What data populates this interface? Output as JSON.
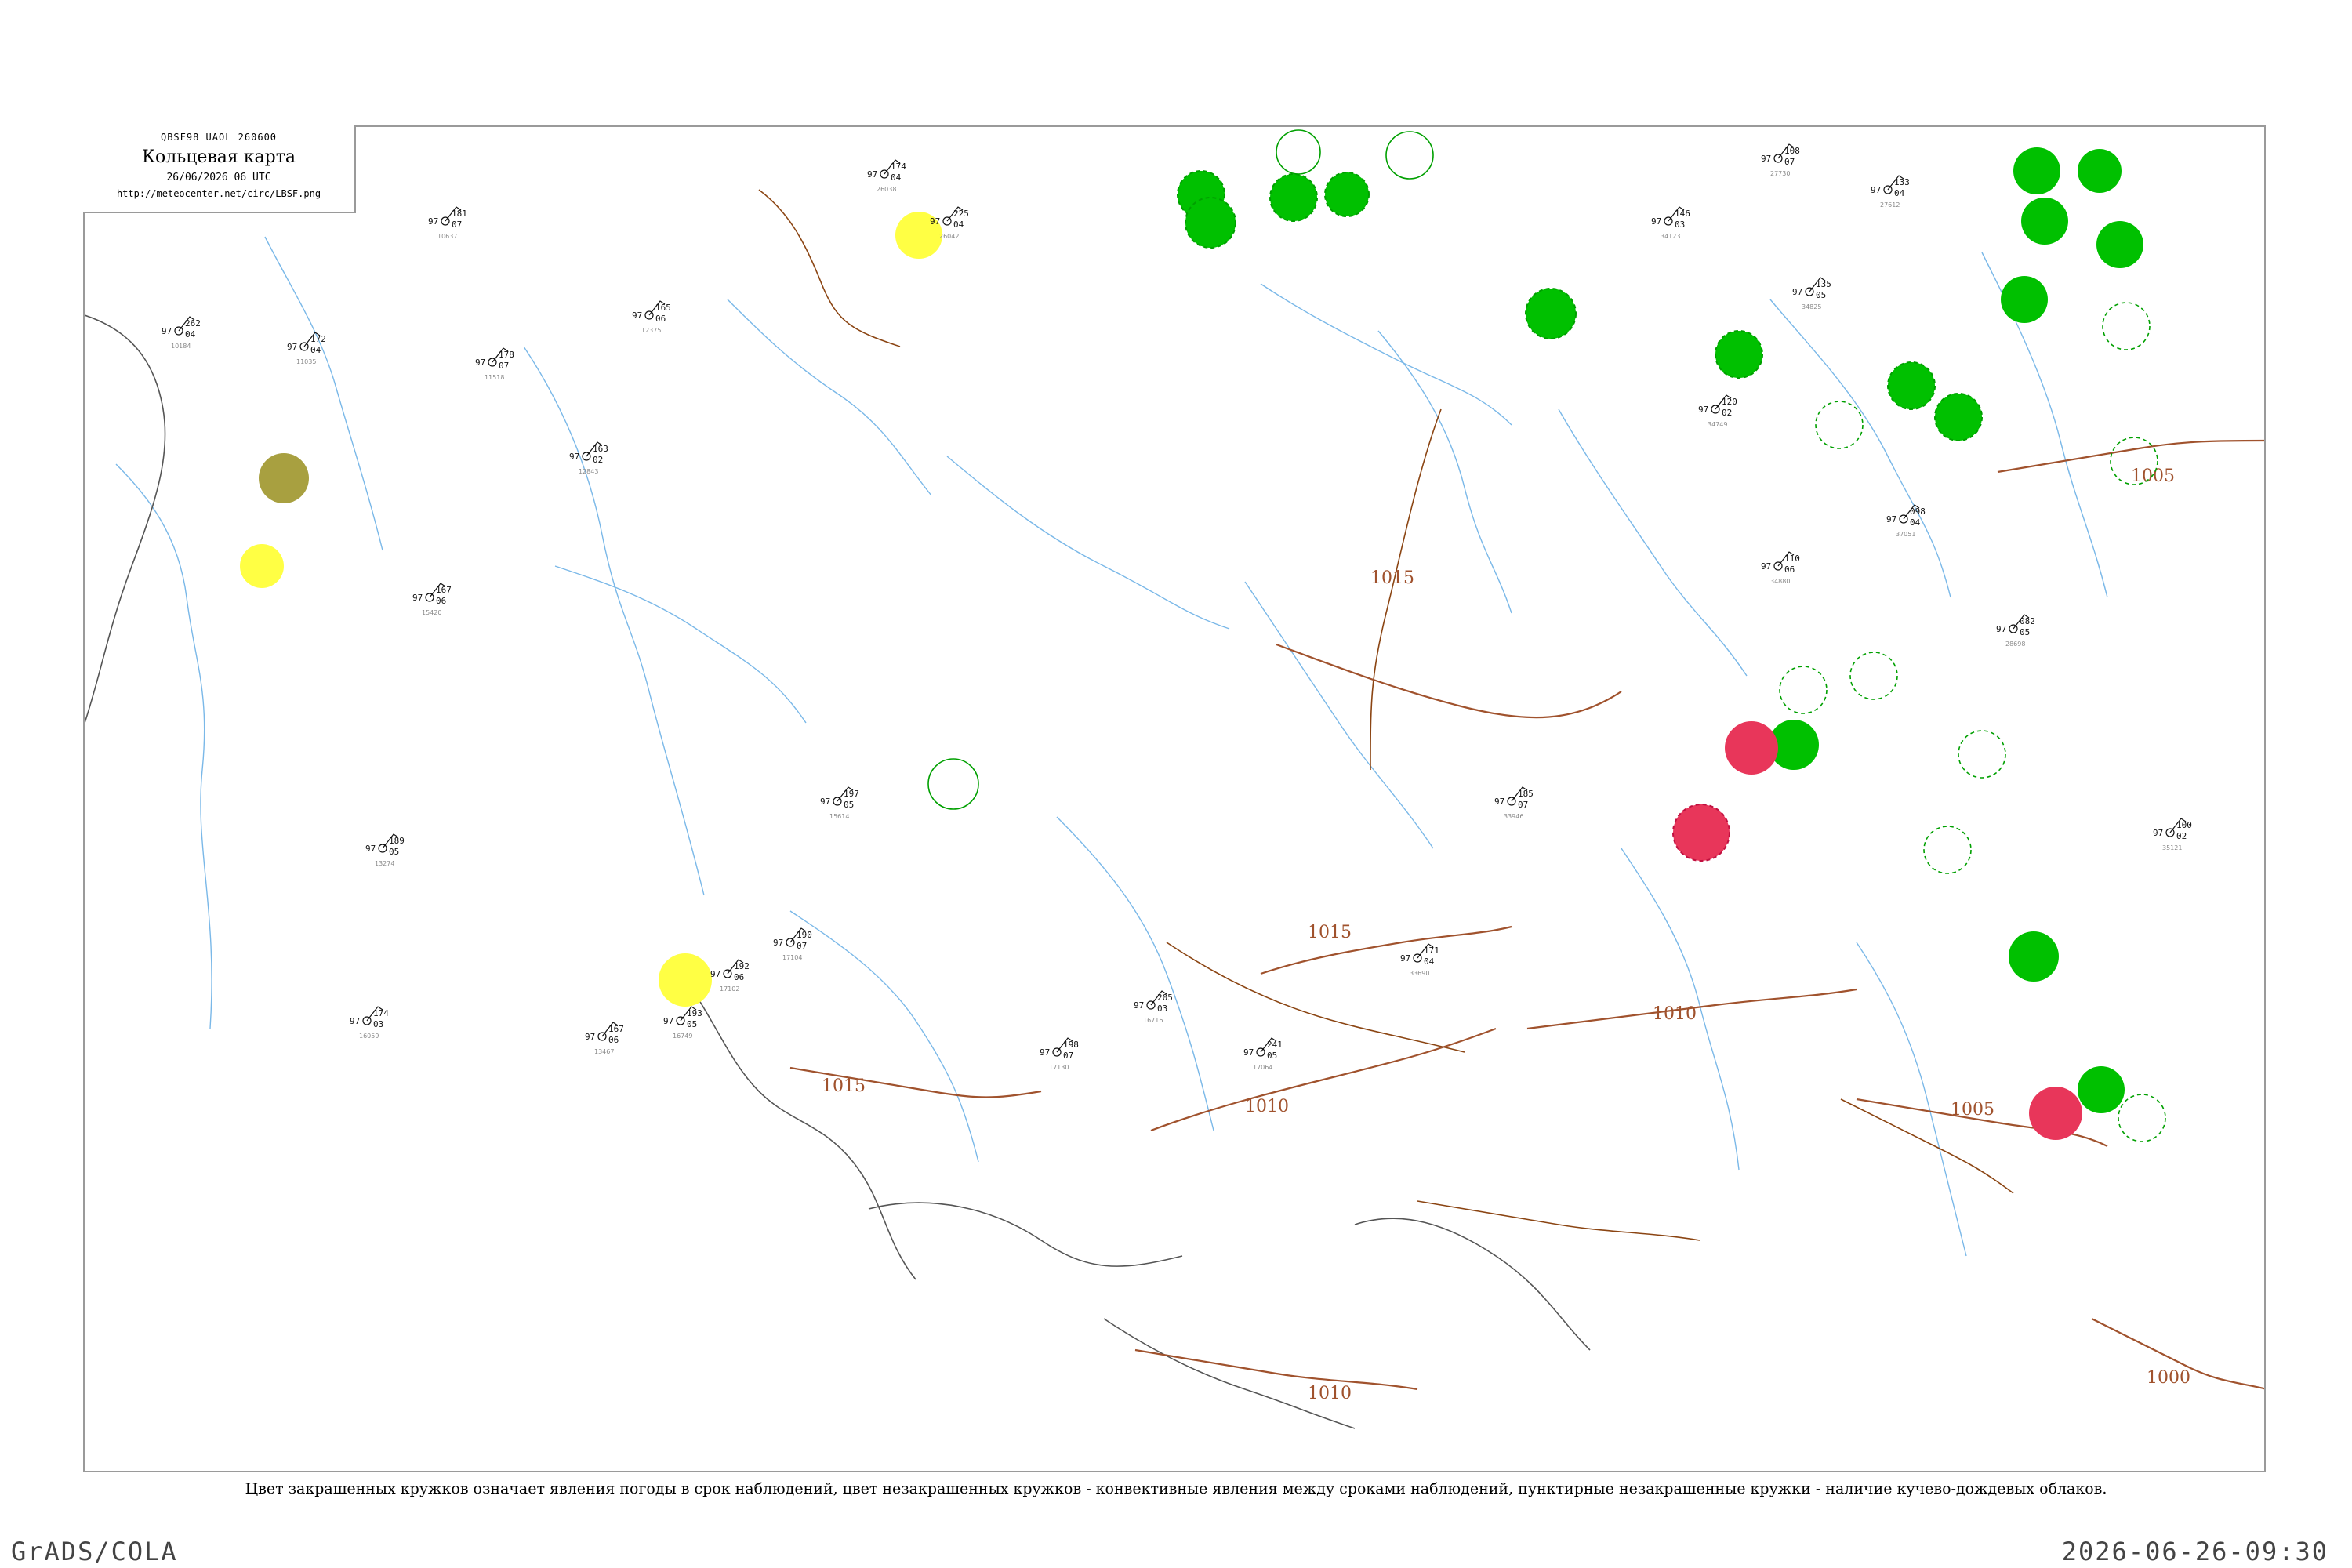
{
  "header": {
    "code_line": "QBSF98  UAOL  260600",
    "title": "Кольцевая карта",
    "date": "26/06/2026 06 UTC",
    "url": "http://meteocenter.net/circ/LBSF.png"
  },
  "caption": "Цвет закрашенных кружков означает явления погоды в срок наблюдений, цвет незакрашенных кружков - конвективные явления между сроками наблюдений, пунктирные незакрашенные кружки - наличие кучево-дождевых облаков.",
  "footer": {
    "left": "GrADS/COLA",
    "right": "2026-06-26-09:30"
  },
  "isobars": [
    {
      "label": "1015"
    },
    {
      "label": "1015"
    },
    {
      "label": "1015"
    },
    {
      "label": "1010"
    },
    {
      "label": "1010"
    },
    {
      "label": "1010"
    },
    {
      "label": "1005"
    },
    {
      "label": "1005"
    },
    {
      "label": "1000"
    }
  ],
  "colors": {
    "rain": "#00c000",
    "thunder": "#e8365a",
    "fog": "#ffff44",
    "haze": "#a8a040",
    "isobar": "#a0522d",
    "river": "#7ab8e8",
    "border": "#555555"
  },
  "stations": [
    {
      "id": "17102",
      "p": "192",
      "v": "06",
      "t": "97"
    },
    {
      "id": "17104",
      "p": "190",
      "v": "07",
      "t": "97"
    },
    {
      "id": "16749",
      "p": "193",
      "v": "05",
      "t": "97"
    },
    {
      "id": "13467",
      "p": "167",
      "v": "06",
      "t": "97"
    },
    {
      "id": "26038",
      "p": "174",
      "v": "04",
      "t": "97"
    },
    {
      "id": "26042",
      "p": "225",
      "v": "04",
      "t": "97"
    },
    {
      "id": "34123",
      "p": "146",
      "v": "03",
      "t": "97"
    },
    {
      "id": "34825",
      "p": "135",
      "v": "05",
      "t": "97"
    },
    {
      "id": "34749",
      "p": "120",
      "v": "02",
      "t": "97"
    },
    {
      "id": "37051",
      "p": "098",
      "v": "04",
      "t": "97"
    },
    {
      "id": "34880",
      "p": "110",
      "v": "06",
      "t": "97"
    },
    {
      "id": "33946",
      "p": "185",
      "v": "07",
      "t": "97"
    },
    {
      "id": "33690",
      "p": "171",
      "v": "04",
      "t": "97"
    },
    {
      "id": "16716",
      "p": "205",
      "v": "03",
      "t": "97"
    },
    {
      "id": "17064",
      "p": "241",
      "v": "05",
      "t": "97"
    },
    {
      "id": "17130",
      "p": "198",
      "v": "07",
      "t": "97"
    },
    {
      "id": "27612",
      "p": "133",
      "v": "04",
      "t": "97"
    },
    {
      "id": "27730",
      "p": "108",
      "v": "07",
      "t": "97"
    },
    {
      "id": "28698",
      "p": "082",
      "v": "05",
      "t": "97"
    },
    {
      "id": "35121",
      "p": "100",
      "v": "02",
      "t": "97"
    },
    {
      "id": "12375",
      "p": "165",
      "v": "06",
      "t": "97"
    },
    {
      "id": "11518",
      "p": "178",
      "v": "07",
      "t": "97"
    },
    {
      "id": "11035",
      "p": "172",
      "v": "04",
      "t": "97"
    },
    {
      "id": "15420",
      "p": "167",
      "v": "06",
      "t": "97"
    },
    {
      "id": "13274",
      "p": "189",
      "v": "05",
      "t": "97"
    },
    {
      "id": "16059",
      "p": "174",
      "v": "03",
      "t": "97"
    },
    {
      "id": "10637",
      "p": "181",
      "v": "07",
      "t": "97"
    },
    {
      "id": "10184",
      "p": "262",
      "v": "04",
      "t": "97"
    },
    {
      "id": "12843",
      "p": "163",
      "v": "02",
      "t": "97"
    },
    {
      "id": "15614",
      "p": "197",
      "v": "05",
      "t": "97"
    }
  ]
}
